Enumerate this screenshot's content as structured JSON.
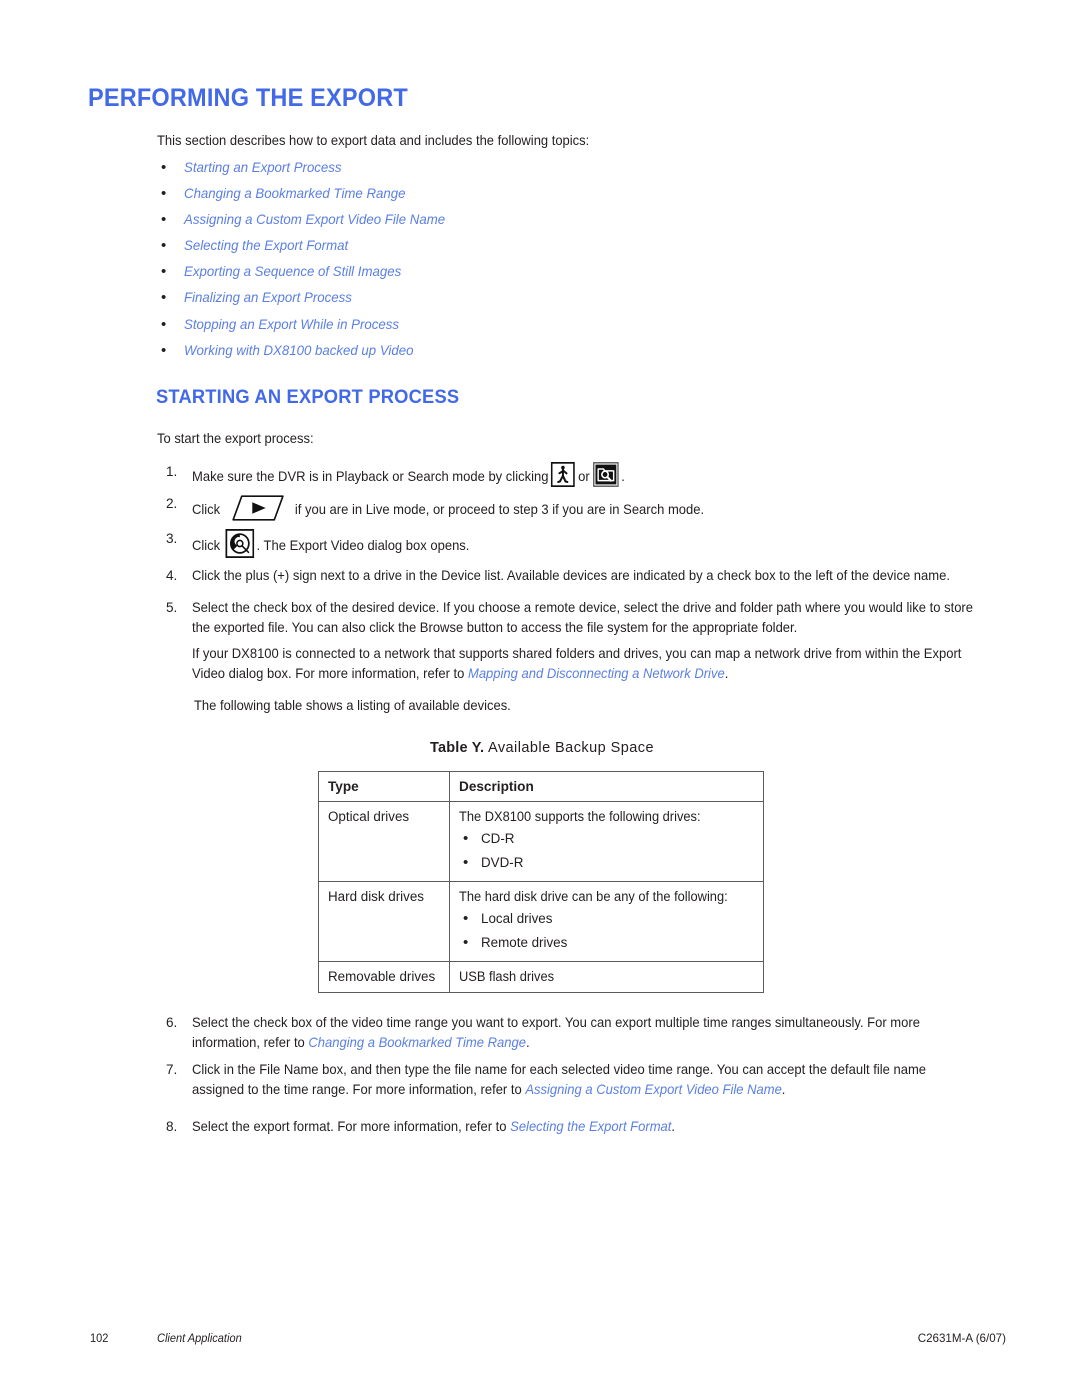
{
  "page": {
    "title": "PERFORMING THE EXPORT",
    "intro": "This section describes how to export data and includes the following topics:",
    "heading_color": "#4169e8",
    "link_color": "#5a7fe4",
    "text_color": "#231f20"
  },
  "topics": [
    {
      "label": "Starting an Export Process"
    },
    {
      "label": "Changing a Bookmarked Time Range"
    },
    {
      "label": "Assigning a Custom Export Video File Name"
    },
    {
      "label": "Selecting the Export Format"
    },
    {
      "label": "Exporting a Sequence of Still Images"
    },
    {
      "label": "Finalizing an Export Process"
    },
    {
      "label": "Stopping an Export While in Process"
    },
    {
      "label": "Working with DX8100 backed up Video"
    }
  ],
  "section": {
    "heading": "STARTING AN EXPORT PROCESS",
    "lead": "To start the export process:"
  },
  "steps": {
    "s1": {
      "num": "1.",
      "a": "Make sure the DVR is in Playback or Search mode by clicking",
      "b": "or",
      "c": "."
    },
    "s2": {
      "num": "2.",
      "a": "Click",
      "b": "if you are in Live mode, or proceed to step 3 if you are in Search mode."
    },
    "s3": {
      "num": "3.",
      "a": "Click",
      "b": ". The Export Video dialog box opens."
    },
    "s4": {
      "num": "4.",
      "text": "Click the plus (+) sign next to a drive in the Device list. Available devices are indicated by a check box to the left of the device name."
    },
    "s5": {
      "num": "5.",
      "text": "Select the check box of the desired device. If you choose a remote device, select the drive and folder path where you would like to store the exported file. You can also click the Browse button to access the file system for the appropriate folder."
    },
    "s5_note": {
      "a": "If your DX8100 is connected to a network that supports shared folders and drives, you can map a network drive from within the Export Video dialog box. For more information, refer to ",
      "link": "Mapping and Disconnecting a Network Drive",
      "b": "."
    },
    "s6": {
      "num": "6.",
      "a": "Select the check box of the video time range you want to export. You can export multiple time ranges simultaneously. For more information, refer to ",
      "link": "Changing a Bookmarked Time Range",
      "b": "."
    },
    "s7": {
      "num": "7.",
      "a": "Click in the File Name box, and then type the file name for each selected video time range. You can accept the default file name assigned to the time range. For more information, refer to ",
      "link": "Assigning a Custom Export Video File Name",
      "b": "."
    },
    "s8": {
      "num": "8.",
      "a": "Select the export format. For more information, refer to ",
      "link": "Selecting the Export Format",
      "b": "."
    }
  },
  "icons": {
    "playback": "walking-person-icon",
    "search": "folder-search-icon",
    "live_play": "play-parallelogram-icon",
    "export_disc": "disc-export-icon"
  },
  "table_intro": "The following table shows a listing of available devices.",
  "table": {
    "caption_label": "Table Y.",
    "caption_title": "Available Backup Space",
    "headers": [
      "Type",
      "Description"
    ],
    "rows": [
      {
        "type": "Optical drives",
        "desc_lead": "The DX8100 supports the following drives:",
        "desc_bullets": [
          "CD-R",
          "DVD-R"
        ]
      },
      {
        "type": "Hard disk drives",
        "desc_lead": "The hard disk drive can be any of the following:",
        "desc_bullets": [
          "Local drives",
          "Remote drives"
        ]
      },
      {
        "type": "Removable drives",
        "desc_lead": "USB flash drives",
        "desc_bullets": []
      }
    ]
  },
  "footer": {
    "page_number": "102",
    "doc_title": "Client Application",
    "doc_code": "C2631M-A (6/07)"
  }
}
